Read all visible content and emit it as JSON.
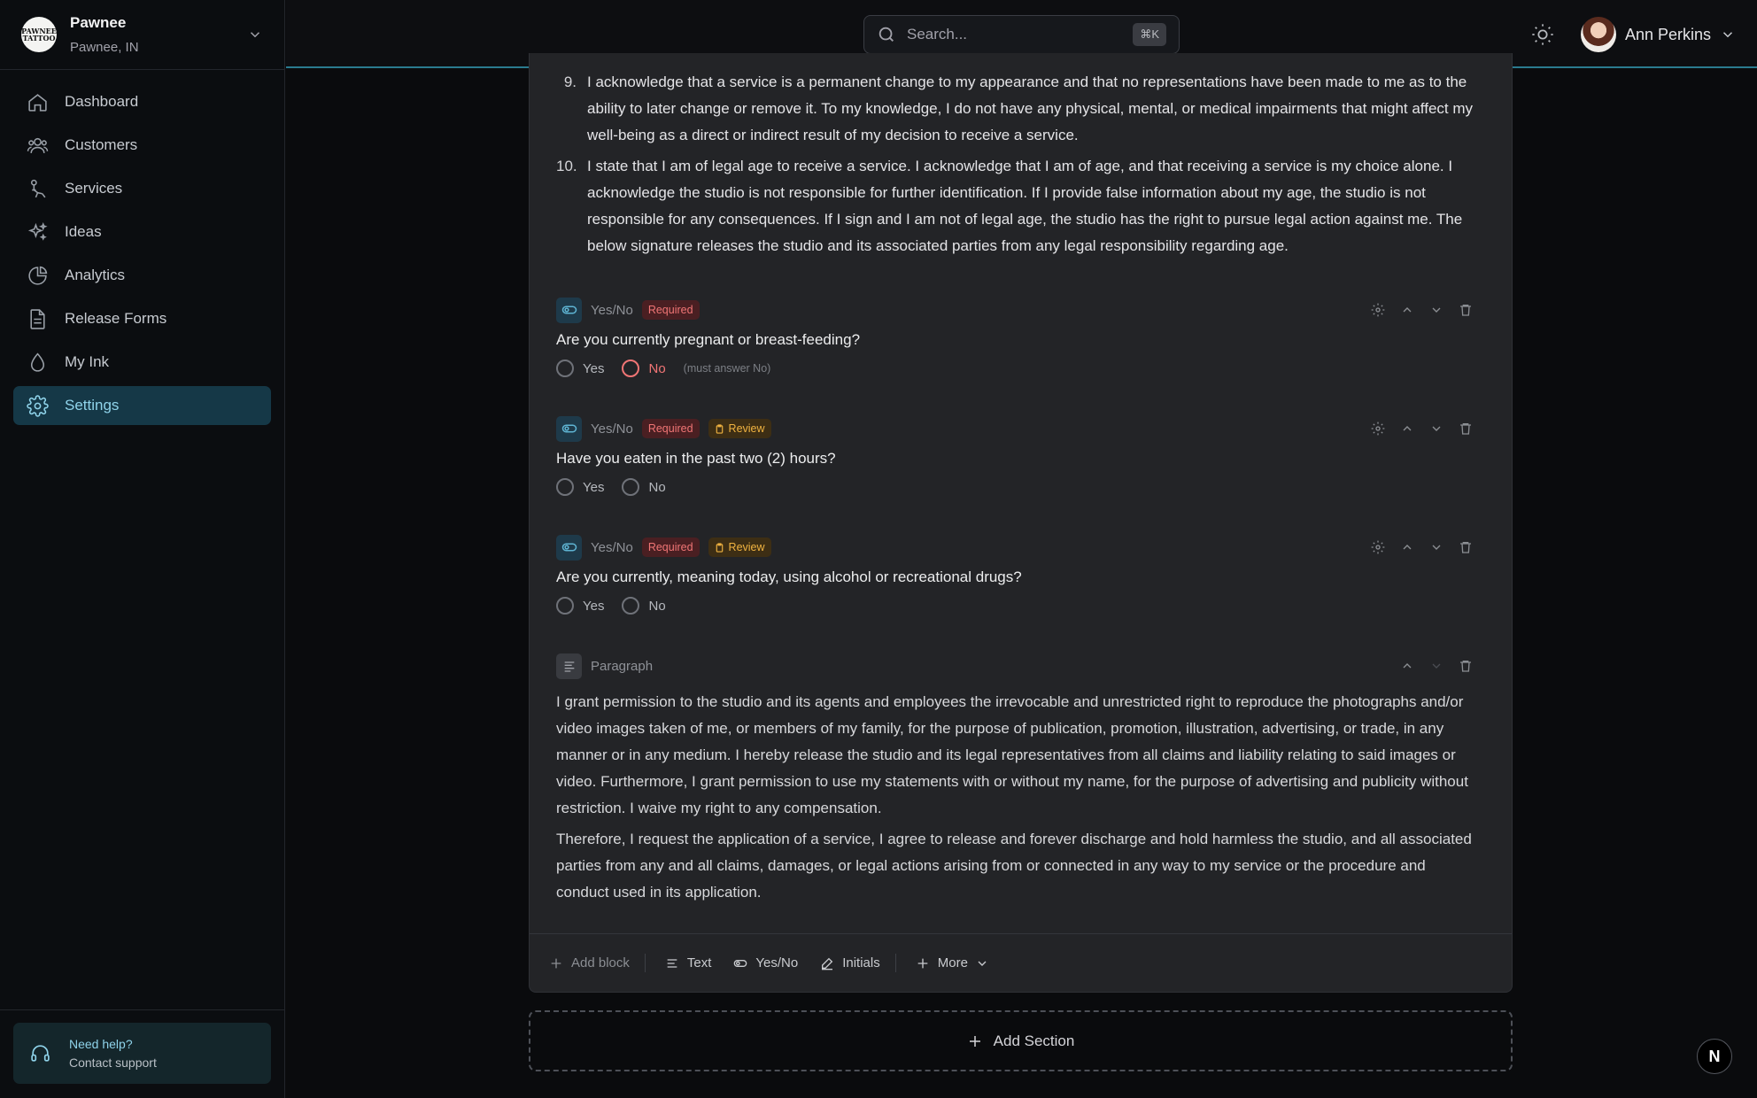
{
  "brand": {
    "logo_text": "PAWNEE TATTOO",
    "name": "Pawnee",
    "location": "Pawnee, IN"
  },
  "nav": [
    {
      "label": "Dashboard",
      "icon": "home-icon"
    },
    {
      "label": "Customers",
      "icon": "users-icon"
    },
    {
      "label": "Services",
      "icon": "tattoo-machine-icon"
    },
    {
      "label": "Ideas",
      "icon": "sparkles-icon"
    },
    {
      "label": "Analytics",
      "icon": "pie-chart-icon"
    },
    {
      "label": "Release Forms",
      "icon": "document-icon"
    },
    {
      "label": "My Ink",
      "icon": "droplet-icon"
    },
    {
      "label": "Settings",
      "icon": "gear-icon",
      "active": true
    }
  ],
  "help": {
    "title": "Need help?",
    "subtitle": "Contact support"
  },
  "search": {
    "placeholder": "Search...",
    "shortcut": "⌘K"
  },
  "user": {
    "name": "Ann Perkins"
  },
  "terms": [
    {
      "num": "9.",
      "text": "I acknowledge that a service is a permanent change to my appearance and that no representations have been made to me as to the ability to later change or remove it. To my knowledge, I do not have any physical, mental, or medical impairments that might affect my well-being as a direct or indirect result of my decision to receive a service."
    },
    {
      "num": "10.",
      "text": "I state that I am of legal age to receive a service. I acknowledge that I am of age, and that receiving a service is my choice alone. I acknowledge the studio is not responsible for further identification. If I provide false information about my age, the studio is not responsible for any consequences. If I sign and I am not of legal age, the studio has the right to pursue legal action against me. The below signature releases the studio and its associated parties from any legal responsibility regarding age."
    }
  ],
  "questions": [
    {
      "type": "Yes/No",
      "required": "Required",
      "review": null,
      "text": "Are you currently pregnant or breast-feeding?",
      "yes": "Yes",
      "no": "No",
      "hint": "(must answer No)"
    },
    {
      "type": "Yes/No",
      "required": "Required",
      "review": "Review",
      "text": "Have you eaten in the past two (2) hours?",
      "yes": "Yes",
      "no": "No"
    },
    {
      "type": "Yes/No",
      "required": "Required",
      "review": "Review",
      "text": "Are you currently, meaning today, using alcohol or recreational drugs?",
      "yes": "Yes",
      "no": "No"
    }
  ],
  "paragraph": {
    "type": "Paragraph",
    "p1": "I grant permission to the studio and its agents and employees the irrevocable and unrestricted right to reproduce the photographs and/or video images taken of me, or members of my family, for the purpose of publication, promotion, illustration, advertising, or trade, in any manner or in any medium. I hereby release the studio and its legal representatives from all claims and liability relating to said images or video. Furthermore, I grant permission to use my statements with or without my name, for the purpose of advertising and publicity without restriction. I waive my right to any compensation.",
    "p2": "Therefore, I request the application of a service, I agree to release and forever discharge and hold harmless the studio, and all associated parties from any and all claims, damages, or legal actions arising from or connected in any way to my service or the procedure and conduct used in its application."
  },
  "toolbar": {
    "add_block": "Add block",
    "text": "Text",
    "yesno": "Yes/No",
    "initials": "Initials",
    "more": "More"
  },
  "add_section": "Add Section",
  "n_badge": "N",
  "colors": {
    "accent": "#8fd3ea",
    "active_bg": "#153847",
    "required": "#f07575",
    "review": "#f0b341"
  }
}
